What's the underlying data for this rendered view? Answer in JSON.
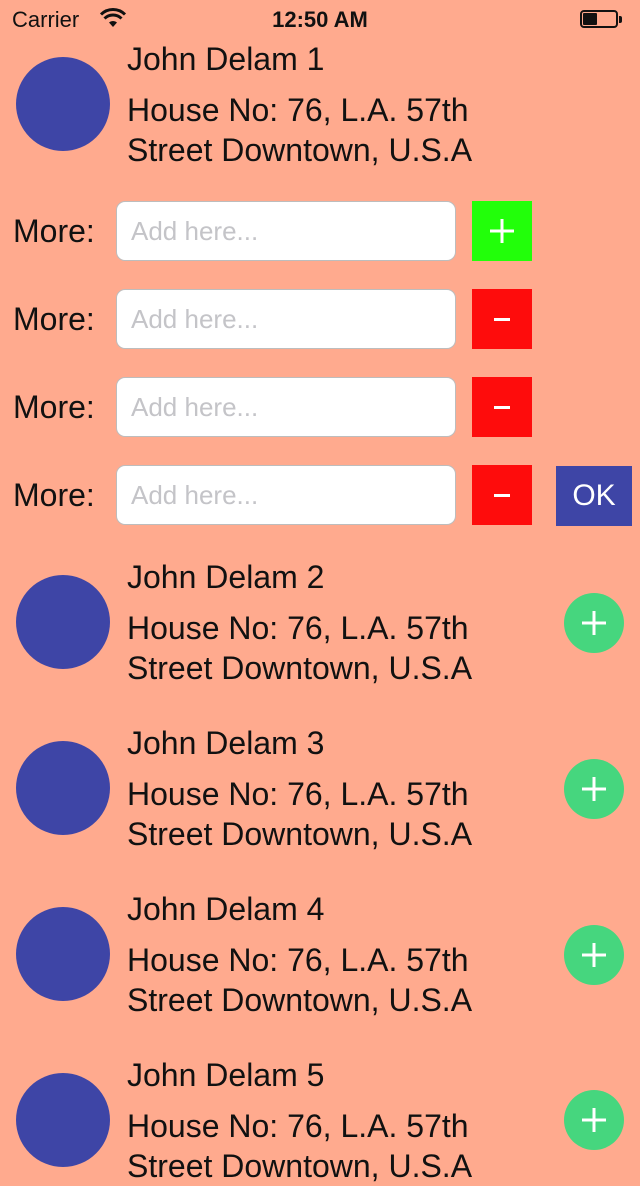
{
  "status_bar": {
    "carrier": "Carrier",
    "time": "12:50 AM",
    "wifi_icon": "wifi-icon",
    "battery_icon": "battery-icon",
    "battery_level": 0.45
  },
  "contacts": [
    {
      "name": "John Delam 1",
      "address": "House No: 76, L.A. 57th Street Downtown, U.S.A"
    },
    {
      "name": "John Delam 2",
      "address": "House No: 76, L.A. 57th Street Downtown, U.S.A"
    },
    {
      "name": "John Delam 3",
      "address": "House No: 76, L.A. 57th Street Downtown, U.S.A"
    },
    {
      "name": "John Delam 4",
      "address": "House No: 76, L.A. 57th Street Downtown, U.S.A"
    },
    {
      "name": "John Delam 5",
      "address": "House No: 76, L.A. 57th Street Downtown, U.S.A"
    }
  ],
  "more_rows": [
    {
      "label": "More:",
      "value": "",
      "placeholder": "Add here...",
      "button": "plus",
      "button_icon": "plus-icon",
      "button_color": "#22FF0A"
    },
    {
      "label": "More:",
      "value": "",
      "placeholder": "Add here...",
      "button": "minus",
      "button_icon": "minus-icon",
      "button_color": "#FE0C0C"
    },
    {
      "label": "More:",
      "value": "",
      "placeholder": "Add here...",
      "button": "minus",
      "button_icon": "minus-icon",
      "button_color": "#FE0C0C"
    },
    {
      "label": "More:",
      "value": "",
      "placeholder": "Add here...",
      "button": "minus",
      "button_icon": "minus-icon",
      "button_color": "#FE0C0C"
    }
  ],
  "ok_button": {
    "label": "OK",
    "color": "#3E45A6"
  },
  "contact_add_button": {
    "icon": "plus-circle-icon",
    "color": "#46D67E"
  },
  "colors": {
    "background": "#FFAA8E",
    "avatar": "#3E45A6",
    "text": "#111111"
  }
}
